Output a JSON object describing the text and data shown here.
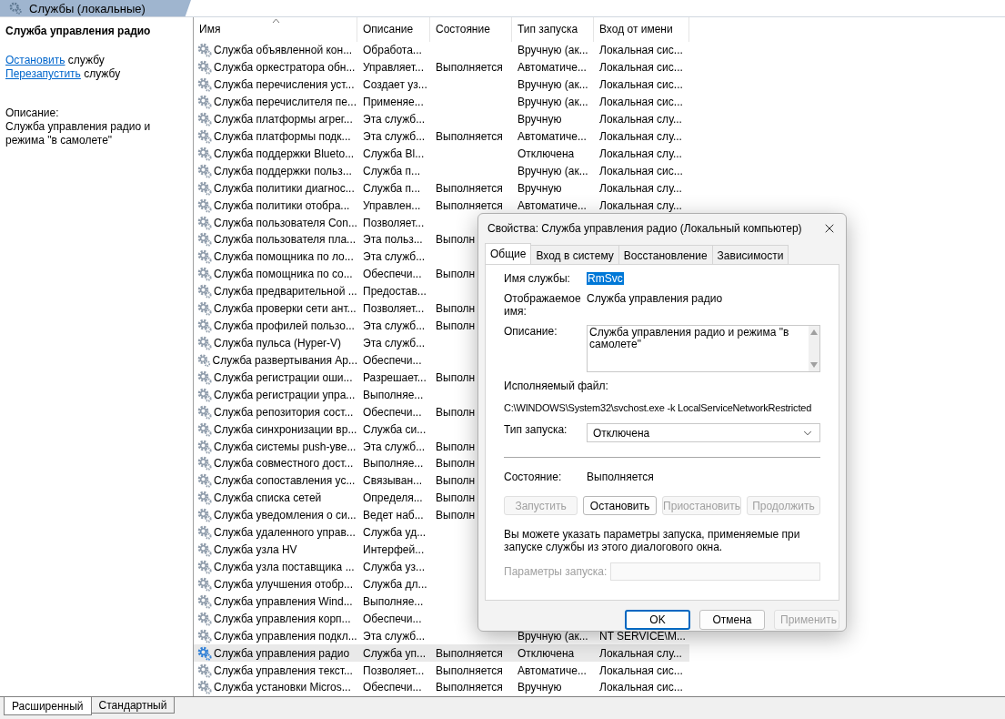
{
  "header": {
    "title": "Службы (локальные)"
  },
  "left_panel": {
    "title": "Служба управления радио",
    "actions": [
      {
        "link": "Остановить",
        "text": "службу"
      },
      {
        "link": "Перезапустить",
        "text": "службу"
      }
    ],
    "description_label": "Описание:",
    "description": "Служба управления радио и режима \"в самолете\""
  },
  "table": {
    "columns": [
      {
        "label": "Имя",
        "sorted": true
      },
      {
        "label": "Описание",
        "sorted": false
      },
      {
        "label": "Состояние",
        "sorted": false
      },
      {
        "label": "Тип запуска",
        "sorted": false
      },
      {
        "label": "Вход от имени",
        "sorted": false
      }
    ],
    "rows": [
      {
        "name": "Служба объявленной кон...",
        "description": "Обработа...",
        "startup": "Вручную (ак...",
        "logon": "Локальная сис...",
        "selected": false
      },
      {
        "name": "Служба оркестратора обн...",
        "description": "Управляет...",
        "status": "Выполняется",
        "startup": "Автоматиче...",
        "logon": "Локальная сис...",
        "selected": false
      },
      {
        "name": "Служба перечисления уст...",
        "description": "Создает уз...",
        "startup": "Вручную (ак...",
        "logon": "Локальная сис...",
        "selected": false
      },
      {
        "name": "Служба перечислителя пе...",
        "description": "Применяе...",
        "startup": "Вручную (ак...",
        "logon": "Локальная сис...",
        "selected": false
      },
      {
        "name": "Служба платформы агрег...",
        "description": "Эта служб...",
        "startup": "Вручную",
        "logon": "Локальная слу...",
        "selected": false
      },
      {
        "name": "Служба платформы подк...",
        "description": "Эта служб...",
        "status": "Выполняется",
        "startup": "Автоматиче...",
        "logon": "Локальная слу...",
        "selected": false
      },
      {
        "name": "Служба поддержки Blueto...",
        "description": "Служба Bl...",
        "startup": "Отключена",
        "logon": "Локальная слу...",
        "selected": false
      },
      {
        "name": "Служба поддержки польз...",
        "description": "Служба п...",
        "startup": "Вручную (ак...",
        "logon": "Локальная сис...",
        "selected": false
      },
      {
        "name": "Служба политики диагнос...",
        "description": "Служба п...",
        "status": "Выполняется",
        "startup": "Вручную",
        "logon": "Локальная слу...",
        "selected": false
      },
      {
        "name": "Служба политики отобра...",
        "description": "Управлен...",
        "status": "Выполняется",
        "startup": "Автоматиче...",
        "logon": "Локальная слу...",
        "selected": false
      },
      {
        "name": "Служба пользователя Con...",
        "description": "Позволяет...",
        "selected": false
      },
      {
        "name": "Служба пользователя пла...",
        "description": "Эта польз...",
        "status": "Выполн",
        "selected": false
      },
      {
        "name": "Служба помощника по ло...",
        "description": "Эта служб...",
        "selected": false
      },
      {
        "name": "Служба помощника по со...",
        "description": "Обеспечи...",
        "status": "Выполн",
        "selected": false
      },
      {
        "name": "Служба предварительной ...",
        "description": "Предостав...",
        "selected": false
      },
      {
        "name": "Служба проверки сети ант...",
        "description": "Позволяет...",
        "status": "Выполн",
        "selected": false
      },
      {
        "name": "Служба профилей пользо...",
        "description": "Эта служб...",
        "status": "Выполн",
        "selected": false
      },
      {
        "name": "Служба пульса (Hyper-V)",
        "description": "Эта служб...",
        "selected": false
      },
      {
        "name": "Служба развертывания Ap...",
        "description": "Обеспечи...",
        "selected": false
      },
      {
        "name": "Служба регистрации оши...",
        "description": "Разрешает...",
        "status": "Выполн",
        "selected": false
      },
      {
        "name": "Служба регистрации упра...",
        "description": "Выполняе...",
        "selected": false
      },
      {
        "name": "Служба репозитория сост...",
        "description": "Обеспечи...",
        "status": "Выполн",
        "selected": false
      },
      {
        "name": "Служба синхронизации вр...",
        "description": "Служба си...",
        "selected": false
      },
      {
        "name": "Служба системы push-уве...",
        "description": "Эта служб...",
        "status": "Выполн",
        "selected": false
      },
      {
        "name": "Служба совместного дост...",
        "description": "Выполняе...",
        "status": "Выполн",
        "selected": false
      },
      {
        "name": "Служба сопоставления ус...",
        "description": "Связыван...",
        "status": "Выполн",
        "selected": false
      },
      {
        "name": "Служба списка сетей",
        "description": "Определя...",
        "status": "Выполн",
        "selected": false
      },
      {
        "name": "Служба уведомления о си...",
        "description": "Ведет наб...",
        "status": "Выполн",
        "selected": false
      },
      {
        "name": "Служба удаленного управ...",
        "description": "Служба уд...",
        "selected": false
      },
      {
        "name": "Служба узла HV",
        "description": "Интерфей...",
        "selected": false
      },
      {
        "name": "Служба узла поставщика ...",
        "description": "Служба уз...",
        "selected": false
      },
      {
        "name": "Служба улучшения отобр...",
        "description": "Служба дл...",
        "selected": false
      },
      {
        "name": "Служба управления Wind...",
        "description": "Выполняе...",
        "selected": false
      },
      {
        "name": "Служба управления корп...",
        "description": "Обеспечи...",
        "selected": false
      },
      {
        "name": "Служба управления подкл...",
        "description": "Эта служб...",
        "startup": "Вручную (ак...",
        "logon": "NT SERVICE\\M...",
        "selected": false
      },
      {
        "name": "Служба управления радио",
        "description": "Служба уп...",
        "status": "Выполняется",
        "startup": "Отключена",
        "logon": "Локальная слу...",
        "selected": true
      },
      {
        "name": "Служба управления текст...",
        "description": "Позволяет...",
        "status": "Выполняется",
        "startup": "Автоматиче...",
        "logon": "Локальная сис...",
        "selected": false
      },
      {
        "name": "Служба установки Micros...",
        "description": "Обеспечи...",
        "status": "Выполняется",
        "startup": "Вручную",
        "logon": "Локальная сис...",
        "selected": false
      }
    ]
  },
  "view_tabs": [
    {
      "label": "Расширенный",
      "selected": true
    },
    {
      "label": "Стандартный",
      "selected": false
    }
  ],
  "dialog": {
    "title": "Свойства: Служба управления радио (Локальный компьютер)",
    "tabs": [
      {
        "label": "Общие",
        "selected": true
      },
      {
        "label": "Вход в систему",
        "selected": false
      },
      {
        "label": "Восстановление",
        "selected": false
      },
      {
        "label": "Зависимости",
        "selected": false
      }
    ],
    "service_name": {
      "label": "Имя службы:",
      "value": "RmSvc",
      "highlighted": true
    },
    "display_name": {
      "label": "Отображаемое имя:",
      "value": "Служба управления радио"
    },
    "description": {
      "label": "Описание:",
      "value": "Служба управления радио и режима \"в самолете\""
    },
    "executable": {
      "label": "Исполняемый файл:",
      "value": "C:\\WINDOWS\\System32\\svchost.exe -k LocalServiceNetworkRestricted"
    },
    "startup_type": {
      "label": "Тип запуска:",
      "value": "Отключена"
    },
    "status": {
      "label": "Состояние:",
      "value": "Выполняется"
    },
    "service_buttons": [
      {
        "label": "Запустить",
        "disabled": true
      },
      {
        "label": "Остановить",
        "disabled": false
      },
      {
        "label": "Приостановить",
        "disabled": true
      },
      {
        "label": "Продолжить",
        "disabled": true
      }
    ],
    "hint": "Вы можете указать параметры запуска, применяемые при запуске службы из этого диалогового окна.",
    "start_params": {
      "label": "Параметры запуска:",
      "disabled": true
    },
    "buttons": [
      {
        "label": "OK",
        "default": true,
        "disabled": false
      },
      {
        "label": "Отмена",
        "default": false,
        "disabled": false
      },
      {
        "label": "Применить",
        "default": false,
        "disabled": true
      }
    ]
  }
}
